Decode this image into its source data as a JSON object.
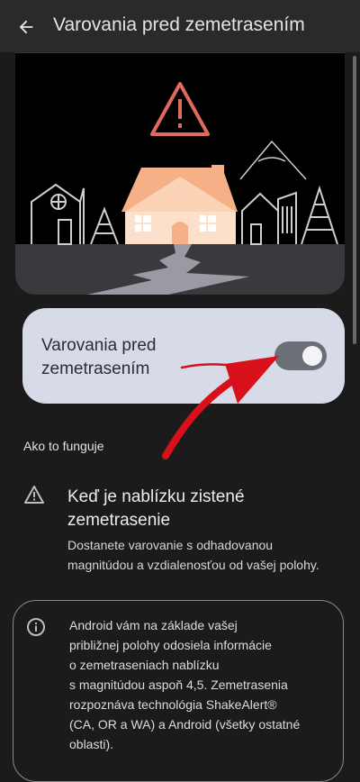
{
  "header": {
    "title": "Varovania pred zemetrasením",
    "back_icon": "arrow-back-icon"
  },
  "toggle": {
    "label": "Varovania pred zemetrasením",
    "state": "off"
  },
  "how_it_works": {
    "section_label": "Ako to funguje",
    "item_title": "Keď je nablízku zistené zemetrasenie",
    "item_description": "Dostanete varovanie s odhadovanou magnitúdou a vzdialenosťou od vašej polohy."
  },
  "info": {
    "text": "Android vám na základe vašej\npribližnej polohy odosiela informácie\no zemetraseniach nablízku\ns magnitúdou aspoň 4,5. Zemetrasenia\nrozpoznáva technológia ShakeAlert®\n(CA, OR a WA) a Android (všetky ostatné\noblasti)."
  },
  "colors": {
    "background": "#1b1b1b",
    "toggle_card": "#d7dbe8",
    "annotation_arrow": "#d8101a",
    "warning_triangle": "#e06a5e",
    "house": "#f6b088"
  }
}
